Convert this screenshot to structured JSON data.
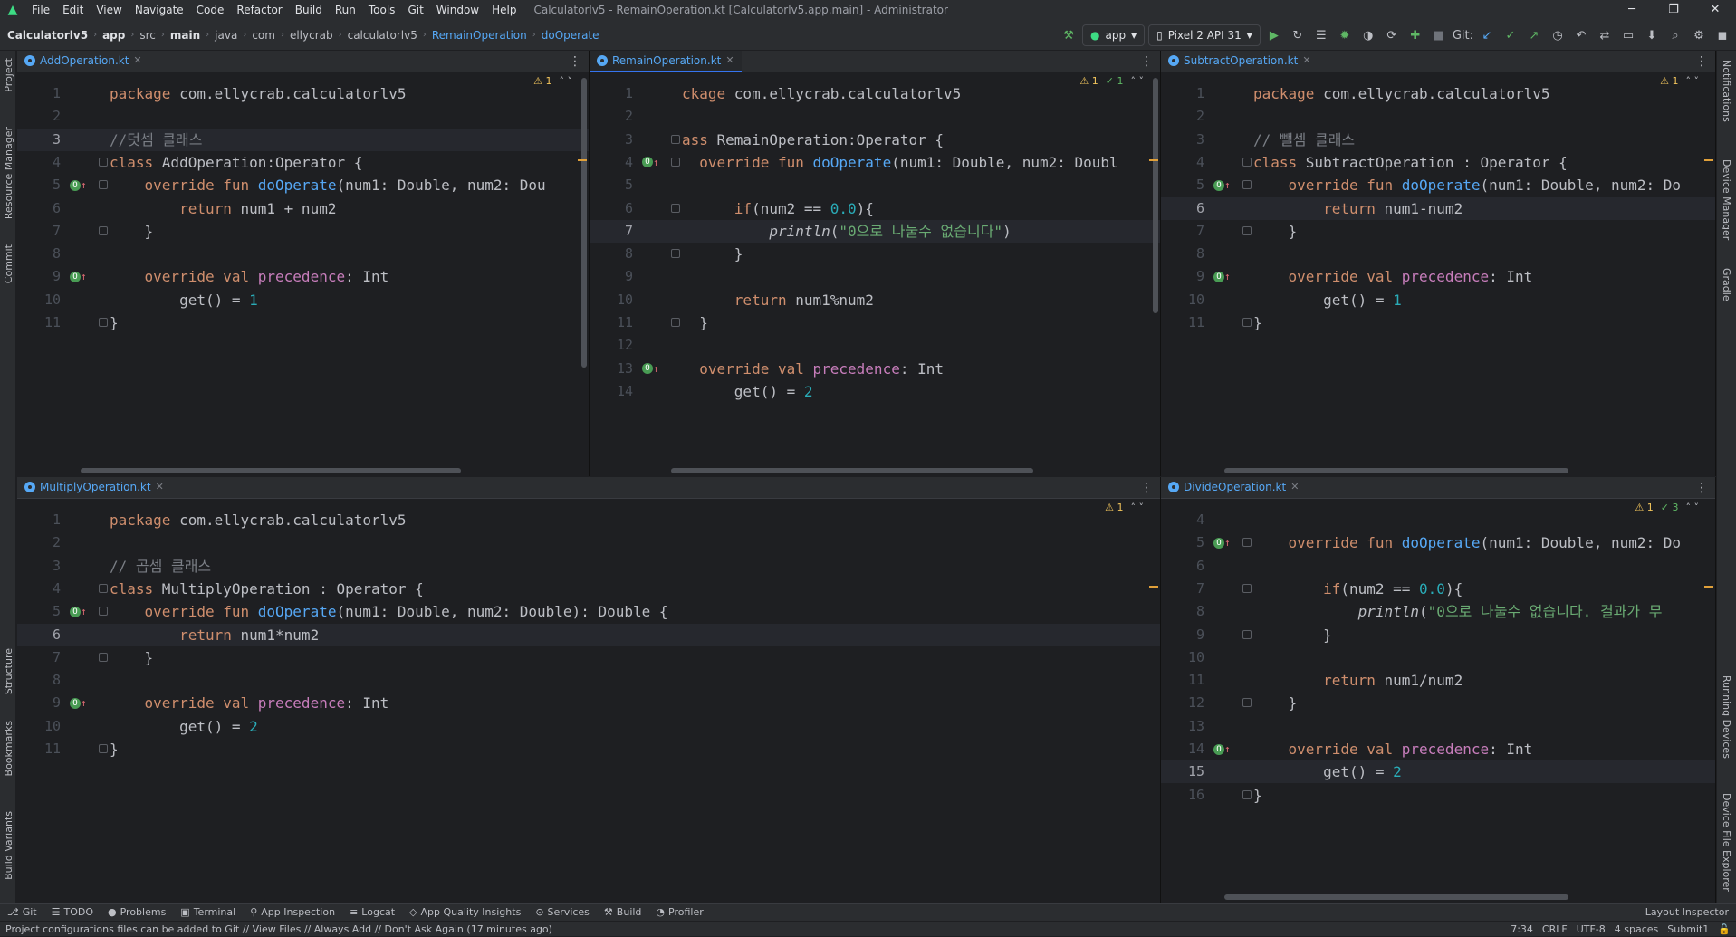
{
  "window": {
    "title": "Calculatorlv5 - RemainOperation.kt [Calculatorlv5.app.main] - Administrator",
    "menu": [
      "File",
      "Edit",
      "View",
      "Navigate",
      "Code",
      "Refactor",
      "Build",
      "Run",
      "Tools",
      "Git",
      "Window",
      "Help"
    ]
  },
  "breadcrumb": [
    "Calculatorlv5",
    "app",
    "src",
    "main",
    "java",
    "com",
    "ellycrab",
    "calculatorlv5",
    "RemainOperation",
    "doOperate"
  ],
  "toolbar": {
    "run_config": "app",
    "device": "Pixel 2 API 31",
    "git_label": "Git:"
  },
  "left_tools": [
    "Project",
    "Resource Manager",
    "Commit",
    "Structure",
    "Bookmarks",
    "Build Variants"
  ],
  "right_tools": [
    "Notifications",
    "Device Manager",
    "Gradle",
    "Running Devices",
    "Device File Explorer"
  ],
  "panes": {
    "add": {
      "tab": "AddOperation.kt",
      "inspect": {
        "warn": "1"
      },
      "lines": [
        {
          "n": "1",
          "t": [
            [
              "kw",
              "package "
            ],
            [
              "",
              "com.ellycrab.calculatorlv5"
            ]
          ]
        },
        {
          "n": "2",
          "t": []
        },
        {
          "n": "3",
          "t": [
            [
              "cm",
              "//덧셈 클래스"
            ]
          ],
          "cur": true
        },
        {
          "n": "4",
          "t": [
            [
              "kw",
              "class "
            ],
            [
              "typ",
              "AddOperation"
            ],
            [
              "",
              ":Operator {"
            ]
          ]
        },
        {
          "n": "5",
          "t": [
            [
              "kw",
              "    override fun "
            ],
            [
              "fn",
              "doOperate"
            ],
            [
              "",
              "(num1: Double, num2: Dou"
            ]
          ]
        },
        {
          "n": "6",
          "t": [
            [
              "kw",
              "        return "
            ],
            [
              "",
              "num1 + num2"
            ]
          ]
        },
        {
          "n": "7",
          "t": [
            [
              "",
              "    }"
            ]
          ]
        },
        {
          "n": "8",
          "t": []
        },
        {
          "n": "9",
          "t": [
            [
              "kw",
              "    override val "
            ],
            [
              "prop",
              "precedence"
            ],
            [
              "",
              ": Int"
            ]
          ]
        },
        {
          "n": "10",
          "t": [
            [
              "",
              "        get() = "
            ],
            [
              "num",
              "1"
            ]
          ]
        },
        {
          "n": "11",
          "t": [
            [
              "",
              "}"
            ]
          ]
        }
      ]
    },
    "remain": {
      "tab": "RemainOperation.kt",
      "inspect": {
        "warn": "1",
        "ok": "1"
      },
      "lines": [
        {
          "n": "1",
          "t": [
            [
              "kw",
              "ckage "
            ],
            [
              "",
              "com.ellycrab.calculatorlv5"
            ]
          ]
        },
        {
          "n": "2",
          "t": []
        },
        {
          "n": "3",
          "t": [
            [
              "kw",
              "ass "
            ],
            [
              "typ",
              "RemainOperation"
            ],
            [
              "",
              ":Operator {"
            ]
          ]
        },
        {
          "n": "4",
          "t": [
            [
              "kw",
              "  override fun "
            ],
            [
              "fn",
              "doOperate"
            ],
            [
              "",
              "(num1: Double, num2: Doubl"
            ]
          ]
        },
        {
          "n": "5",
          "t": []
        },
        {
          "n": "6",
          "t": [
            [
              "kw",
              "      if"
            ],
            [
              "",
              "(num2 == "
            ],
            [
              "num",
              "0.0"
            ],
            [
              "",
              "){"
            ]
          ]
        },
        {
          "n": "7",
          "t": [
            [
              "it",
              "          println"
            ],
            [
              "",
              "("
            ],
            [
              "str",
              "\"0으로 나눌수 없습니다\""
            ],
            [
              "",
              ")"
            ]
          ],
          "cur": true
        },
        {
          "n": "8",
          "t": [
            [
              "",
              "      }"
            ]
          ]
        },
        {
          "n": "9",
          "t": []
        },
        {
          "n": "10",
          "t": [
            [
              "kw",
              "      return "
            ],
            [
              "",
              "num1%num2"
            ]
          ]
        },
        {
          "n": "11",
          "t": [
            [
              "",
              "  }"
            ]
          ]
        },
        {
          "n": "12",
          "t": []
        },
        {
          "n": "13",
          "t": [
            [
              "kw",
              "  override val "
            ],
            [
              "prop",
              "precedence"
            ],
            [
              "",
              ": Int"
            ]
          ]
        },
        {
          "n": "14",
          "t": [
            [
              "",
              "      get() = "
            ],
            [
              "num",
              "2"
            ]
          ]
        }
      ]
    },
    "subtract": {
      "tab": "SubtractOperation.kt",
      "inspect": {
        "warn": "1"
      },
      "lines": [
        {
          "n": "1",
          "t": [
            [
              "kw",
              "package "
            ],
            [
              "",
              "com.ellycrab.calculatorlv5"
            ]
          ]
        },
        {
          "n": "2",
          "t": []
        },
        {
          "n": "3",
          "t": [
            [
              "cm",
              "// 뺄셈 클래스"
            ]
          ]
        },
        {
          "n": "4",
          "t": [
            [
              "kw",
              "class "
            ],
            [
              "typ",
              "SubtractOperation"
            ],
            [
              "",
              " : Operator {"
            ]
          ]
        },
        {
          "n": "5",
          "t": [
            [
              "kw",
              "    override fun "
            ],
            [
              "fn",
              "doOperate"
            ],
            [
              "",
              "(num1: Double, num2: Do"
            ]
          ]
        },
        {
          "n": "6",
          "t": [
            [
              "kw",
              "        return "
            ],
            [
              "",
              "num1-num2"
            ]
          ],
          "cur": true
        },
        {
          "n": "7",
          "t": [
            [
              "",
              "    }"
            ]
          ]
        },
        {
          "n": "8",
          "t": []
        },
        {
          "n": "9",
          "t": [
            [
              "kw",
              "    override val "
            ],
            [
              "prop",
              "precedence"
            ],
            [
              "",
              ": Int"
            ]
          ]
        },
        {
          "n": "10",
          "t": [
            [
              "",
              "        get() = "
            ],
            [
              "num",
              "1"
            ]
          ]
        },
        {
          "n": "11",
          "t": [
            [
              "",
              "}"
            ]
          ]
        }
      ]
    },
    "multiply": {
      "tab": "MultiplyOperation.kt",
      "inspect": {
        "warn": "1"
      },
      "lines": [
        {
          "n": "1",
          "t": [
            [
              "kw",
              "package "
            ],
            [
              "",
              "com.ellycrab.calculatorlv5"
            ]
          ]
        },
        {
          "n": "2",
          "t": []
        },
        {
          "n": "3",
          "t": [
            [
              "cm",
              "// 곱셈 클래스"
            ]
          ]
        },
        {
          "n": "4",
          "t": [
            [
              "kw",
              "class "
            ],
            [
              "typ",
              "MultiplyOperation"
            ],
            [
              "",
              " : Operator {"
            ]
          ]
        },
        {
          "n": "5",
          "t": [
            [
              "kw",
              "    override fun "
            ],
            [
              "fn",
              "doOperate"
            ],
            [
              "",
              "(num1: Double, num2: Double): Double {"
            ]
          ]
        },
        {
          "n": "6",
          "t": [
            [
              "kw",
              "        return "
            ],
            [
              "",
              "num1*num2"
            ]
          ],
          "cur": true
        },
        {
          "n": "7",
          "t": [
            [
              "",
              "    }"
            ]
          ]
        },
        {
          "n": "8",
          "t": []
        },
        {
          "n": "9",
          "t": [
            [
              "kw",
              "    override val "
            ],
            [
              "prop",
              "precedence"
            ],
            [
              "",
              ": Int"
            ]
          ]
        },
        {
          "n": "10",
          "t": [
            [
              "",
              "        get() = "
            ],
            [
              "num",
              "2"
            ]
          ]
        },
        {
          "n": "11",
          "t": [
            [
              "",
              "}"
            ]
          ]
        }
      ]
    },
    "divide": {
      "tab": "DivideOperation.kt",
      "inspect": {
        "warn": "1",
        "ok": "3"
      },
      "lines": [
        {
          "n": "4",
          "t": []
        },
        {
          "n": "5",
          "t": [
            [
              "kw",
              "    override fun "
            ],
            [
              "fn",
              "doOperate"
            ],
            [
              "",
              "(num1: Double, num2: Do"
            ]
          ]
        },
        {
          "n": "6",
          "t": []
        },
        {
          "n": "7",
          "t": [
            [
              "kw",
              "        if"
            ],
            [
              "",
              "(num2 == "
            ],
            [
              "num",
              "0.0"
            ],
            [
              "",
              "){"
            ]
          ]
        },
        {
          "n": "8",
          "t": [
            [
              "it",
              "            println"
            ],
            [
              "",
              "("
            ],
            [
              "str",
              "\"0으로 나눌수 없습니다. 결과가 무"
            ]
          ]
        },
        {
          "n": "9",
          "t": [
            [
              "",
              "        }"
            ]
          ]
        },
        {
          "n": "10",
          "t": []
        },
        {
          "n": "11",
          "t": [
            [
              "kw",
              "        return "
            ],
            [
              "",
              "num1/num2"
            ]
          ]
        },
        {
          "n": "12",
          "t": [
            [
              "",
              "    }"
            ]
          ]
        },
        {
          "n": "13",
          "t": []
        },
        {
          "n": "14",
          "t": [
            [
              "kw",
              "    override val "
            ],
            [
              "prop",
              "precedence"
            ],
            [
              "",
              ": Int"
            ]
          ]
        },
        {
          "n": "15",
          "t": [
            [
              "",
              "        get() = "
            ],
            [
              "num",
              "2"
            ]
          ],
          "cur": true
        },
        {
          "n": "16",
          "t": [
            [
              "",
              "}"
            ]
          ]
        }
      ]
    }
  },
  "bottom_tools": [
    "Git",
    "TODO",
    "Problems",
    "Terminal",
    "App Inspection",
    "Logcat",
    "App Quality Insights",
    "Services",
    "Build",
    "Profiler"
  ],
  "layout_inspector": "Layout Inspector",
  "status": {
    "message": "Project configurations files can be added to Git // View Files // Always Add // Don't Ask Again (17 minutes ago)",
    "position": "7:34",
    "line_sep": "CRLF",
    "encoding": "UTF-8",
    "indent": "4 spaces",
    "branch": "Submit1"
  }
}
